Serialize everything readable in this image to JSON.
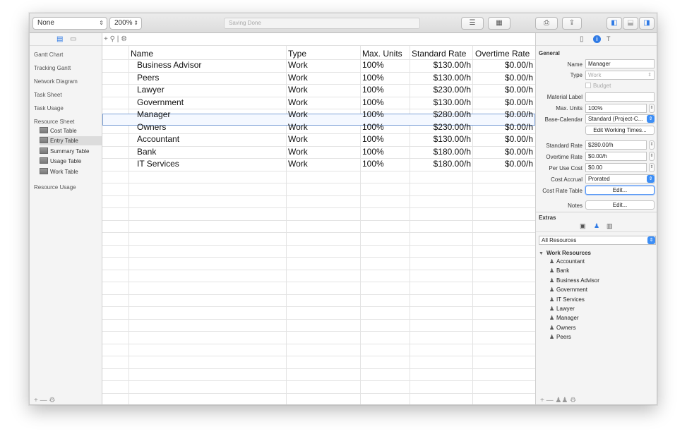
{
  "toolbar": {
    "filter_value": "None",
    "zoom_value": "200%",
    "status": "Saving Done",
    "list_icon": "list-icon",
    "calendar_icon": "calendar-icon",
    "print_icon": "print-icon",
    "share_icon": "share-icon",
    "view_left_icon": "left-pane-icon",
    "view_bottom_icon": "bottom-pane-icon",
    "view_right_icon": "right-pane-icon"
  },
  "sidebar": {
    "items": [
      "Gantt Chart",
      "Tracking Gantt",
      "Network Diagram",
      "Task Sheet",
      "Task Usage",
      "Resource Sheet"
    ],
    "sub_items": [
      "Cost Table",
      "Entry Table",
      "Summary Table",
      "Usage Table",
      "Work Table"
    ],
    "selected_sub": "Entry Table",
    "after_item": "Resource Usage",
    "footer": "+ — ⚙"
  },
  "grid": {
    "tools": "+  ⚲ | ⚙",
    "columns": [
      "Name",
      "Type",
      "Max. Units",
      "Standard Rate",
      "Overtime Rate"
    ],
    "rows": [
      {
        "name": "Business Advisor",
        "type": "Work",
        "max_units": "100%",
        "standard_rate": "$130.00/h",
        "overtime_rate": "$0.00/h"
      },
      {
        "name": "Peers",
        "type": "Work",
        "max_units": "100%",
        "standard_rate": "$130.00/h",
        "overtime_rate": "$0.00/h"
      },
      {
        "name": "Lawyer",
        "type": "Work",
        "max_units": "100%",
        "standard_rate": "$230.00/h",
        "overtime_rate": "$0.00/h"
      },
      {
        "name": "Government",
        "type": "Work",
        "max_units": "100%",
        "standard_rate": "$130.00/h",
        "overtime_rate": "$0.00/h"
      },
      {
        "name": "Manager",
        "type": "Work",
        "max_units": "100%",
        "standard_rate": "$280.00/h",
        "overtime_rate": "$0.00/h"
      },
      {
        "name": "Owners",
        "type": "Work",
        "max_units": "100%",
        "standard_rate": "$230.00/h",
        "overtime_rate": "$0.00/h"
      },
      {
        "name": "Accountant",
        "type": "Work",
        "max_units": "100%",
        "standard_rate": "$130.00/h",
        "overtime_rate": "$0.00/h"
      },
      {
        "name": "Bank",
        "type": "Work",
        "max_units": "100%",
        "standard_rate": "$180.00/h",
        "overtime_rate": "$0.00/h"
      },
      {
        "name": "IT Services",
        "type": "Work",
        "max_units": "100%",
        "standard_rate": "$180.00/h",
        "overtime_rate": "$0.00/h"
      }
    ],
    "selected_row": "Manager"
  },
  "inspector": {
    "general_title": "General",
    "name_label": "Name",
    "name_value": "Manager",
    "type_label": "Type",
    "type_value": "Work",
    "budget_label": "Budget",
    "material_label": "Material Label",
    "material_value": "",
    "max_units_label": "Max. Units",
    "max_units_value": "100%",
    "base_calendar_label": "Base-Calendar",
    "base_calendar_value": "Standard (Project-C...",
    "edit_working_times": "Edit Working Times...",
    "standard_rate_label": "Standard Rate",
    "standard_rate_value": "$280.00/h",
    "overtime_rate_label": "Overtime Rate",
    "overtime_rate_value": "$0.00/h",
    "per_use_cost_label": "Per Use Cost",
    "per_use_cost_value": "$0.00",
    "cost_accrual_label": "Cost Accrual",
    "cost_accrual_value": "Prorated",
    "cost_rate_table_label": "Cost Rate Table",
    "cost_rate_table_button": "Edit...",
    "notes_label": "Notes",
    "notes_button": "Edit...",
    "extras_title": "Extras",
    "filter_value": "All Resources",
    "group_label": "Work Resources",
    "resources": [
      "Accountant",
      "Bank",
      "Business Advisor",
      "Government",
      "IT Services",
      "Lawyer",
      "Manager",
      "Owners",
      "Peers"
    ],
    "footer": "+ —"
  }
}
